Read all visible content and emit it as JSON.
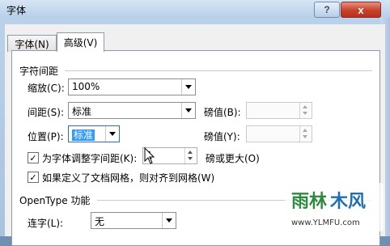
{
  "window": {
    "title": "字体",
    "help_label": "?",
    "close_label": "x"
  },
  "tabs": [
    {
      "label": "字体(N)"
    },
    {
      "label": "高级(V)"
    }
  ],
  "spacing": {
    "section_title": "字符间距",
    "scale_label": "缩放(C):",
    "scale_value": "100%",
    "spacing_label": "间距(S):",
    "spacing_value": "标准",
    "spacing_by_label": "磅值(B):",
    "spacing_by_value": "",
    "position_label": "位置(P):",
    "position_value": "标准",
    "position_by_label": "磅值(Y):",
    "position_by_value": "",
    "kerning_label": "为字体调整字间距(K):",
    "kerning_value": "1",
    "kerning_suffix": "磅或更大(O)",
    "kerning_checked": true,
    "grid_label": "如果定义了文档网格，则对齐到网格(W)",
    "grid_checked": true
  },
  "opentype": {
    "section_title": "OpenType 功能",
    "ligatures_label": "连字(L):",
    "ligatures_value": "无"
  },
  "watermark": {
    "text": "雨林木风",
    "url": "www.YLMFU.com"
  }
}
